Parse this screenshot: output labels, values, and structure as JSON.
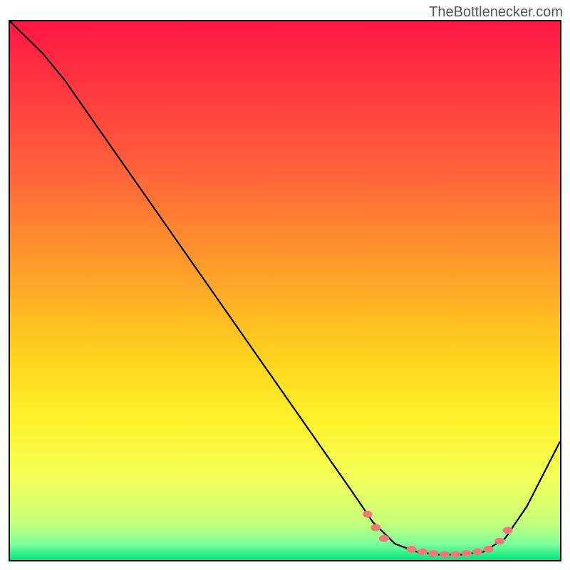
{
  "watermark": "TheBottlenecker.com",
  "chart_data": {
    "type": "line",
    "title": "",
    "xlabel": "",
    "ylabel": "",
    "xlim": [
      0,
      100
    ],
    "ylim": [
      0,
      100
    ],
    "gradient_stops": [
      {
        "offset": 0,
        "color": "#ff1744"
      },
      {
        "offset": 25,
        "color": "#ff5a3c"
      },
      {
        "offset": 45,
        "color": "#ff9a2a"
      },
      {
        "offset": 62,
        "color": "#ffd21f"
      },
      {
        "offset": 74,
        "color": "#fff22a"
      },
      {
        "offset": 85,
        "color": "#f2ff5a"
      },
      {
        "offset": 93,
        "color": "#c8ff7a"
      },
      {
        "offset": 97,
        "color": "#7fff9a"
      },
      {
        "offset": 100,
        "color": "#00e67a"
      }
    ],
    "curve_points": [
      {
        "x": 0,
        "y": 100
      },
      {
        "x": 6,
        "y": 94
      },
      {
        "x": 10,
        "y": 89
      },
      {
        "x": 62,
        "y": 13
      },
      {
        "x": 66,
        "y": 7
      },
      {
        "x": 70,
        "y": 3
      },
      {
        "x": 74,
        "y": 1.5
      },
      {
        "x": 78,
        "y": 1
      },
      {
        "x": 82,
        "y": 1
      },
      {
        "x": 86,
        "y": 1.5
      },
      {
        "x": 90,
        "y": 4
      },
      {
        "x": 94,
        "y": 10
      },
      {
        "x": 100,
        "y": 22
      }
    ],
    "marker_points": [
      {
        "x": 65,
        "y": 8.5
      },
      {
        "x": 66.5,
        "y": 6
      },
      {
        "x": 68,
        "y": 4
      },
      {
        "x": 73,
        "y": 2
      },
      {
        "x": 75,
        "y": 1.5
      },
      {
        "x": 77,
        "y": 1.2
      },
      {
        "x": 79,
        "y": 1
      },
      {
        "x": 81,
        "y": 1
      },
      {
        "x": 83,
        "y": 1.2
      },
      {
        "x": 85,
        "y": 1.5
      },
      {
        "x": 87,
        "y": 2
      },
      {
        "x": 89,
        "y": 3.5
      },
      {
        "x": 90.5,
        "y": 5.5
      }
    ]
  }
}
